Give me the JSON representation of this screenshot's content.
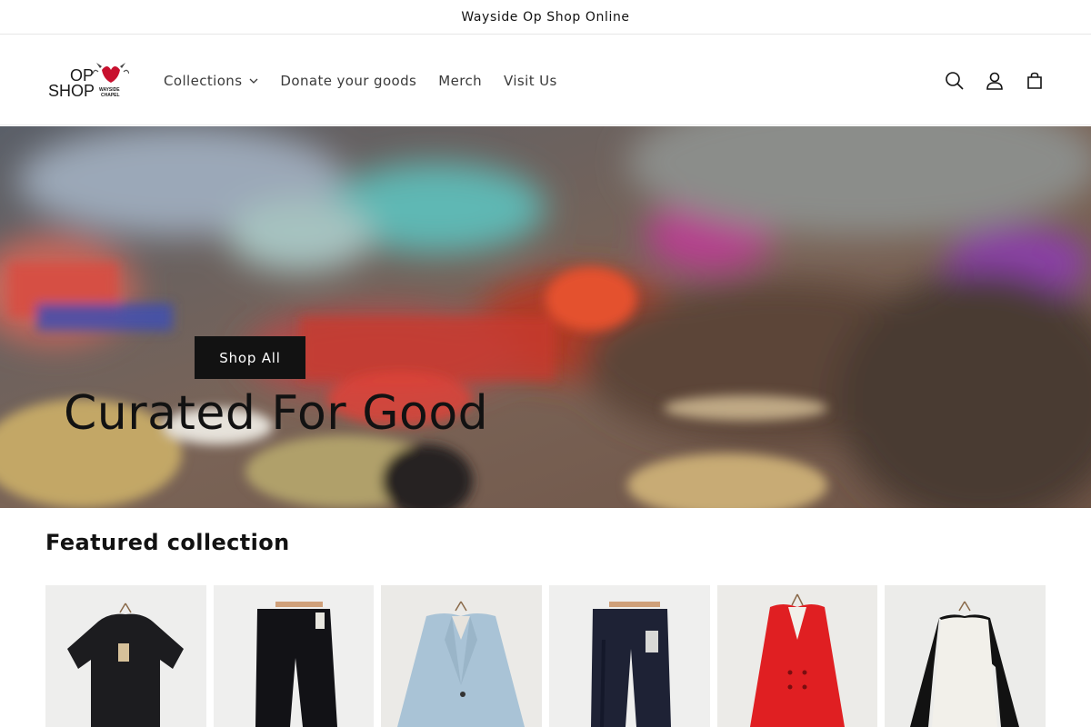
{
  "announcement": {
    "text": "Wayside Op Shop Online"
  },
  "header": {
    "logo": {
      "line1": "OP",
      "line2": "SHOP",
      "brand": "WAYSIDE CHAPEL"
    },
    "nav": [
      {
        "label": "Collections",
        "has_dropdown": true
      },
      {
        "label": "Donate your goods",
        "has_dropdown": false
      },
      {
        "label": "Merch",
        "has_dropdown": false
      },
      {
        "label": "Visit Us",
        "has_dropdown": false
      }
    ],
    "icons": [
      "search-icon",
      "account-icon",
      "cart-icon"
    ]
  },
  "hero": {
    "title": "Curated For Good",
    "button_label": "Shop All"
  },
  "featured": {
    "title": "Featured collection",
    "products": [
      {
        "name": "black polo shirt",
        "color": "#1c1c1f"
      },
      {
        "name": "black jeans",
        "color": "#121216"
      },
      {
        "name": "light blue blazer",
        "color": "#a9c3d6"
      },
      {
        "name": "navy trousers",
        "color": "#1e2235"
      },
      {
        "name": "red blazer",
        "color": "#e01f22"
      },
      {
        "name": "white raglan top",
        "color": "#f2f0ea"
      }
    ]
  },
  "colors": {
    "text": "#121212",
    "button_bg": "#121212",
    "button_text": "#ffffff"
  }
}
